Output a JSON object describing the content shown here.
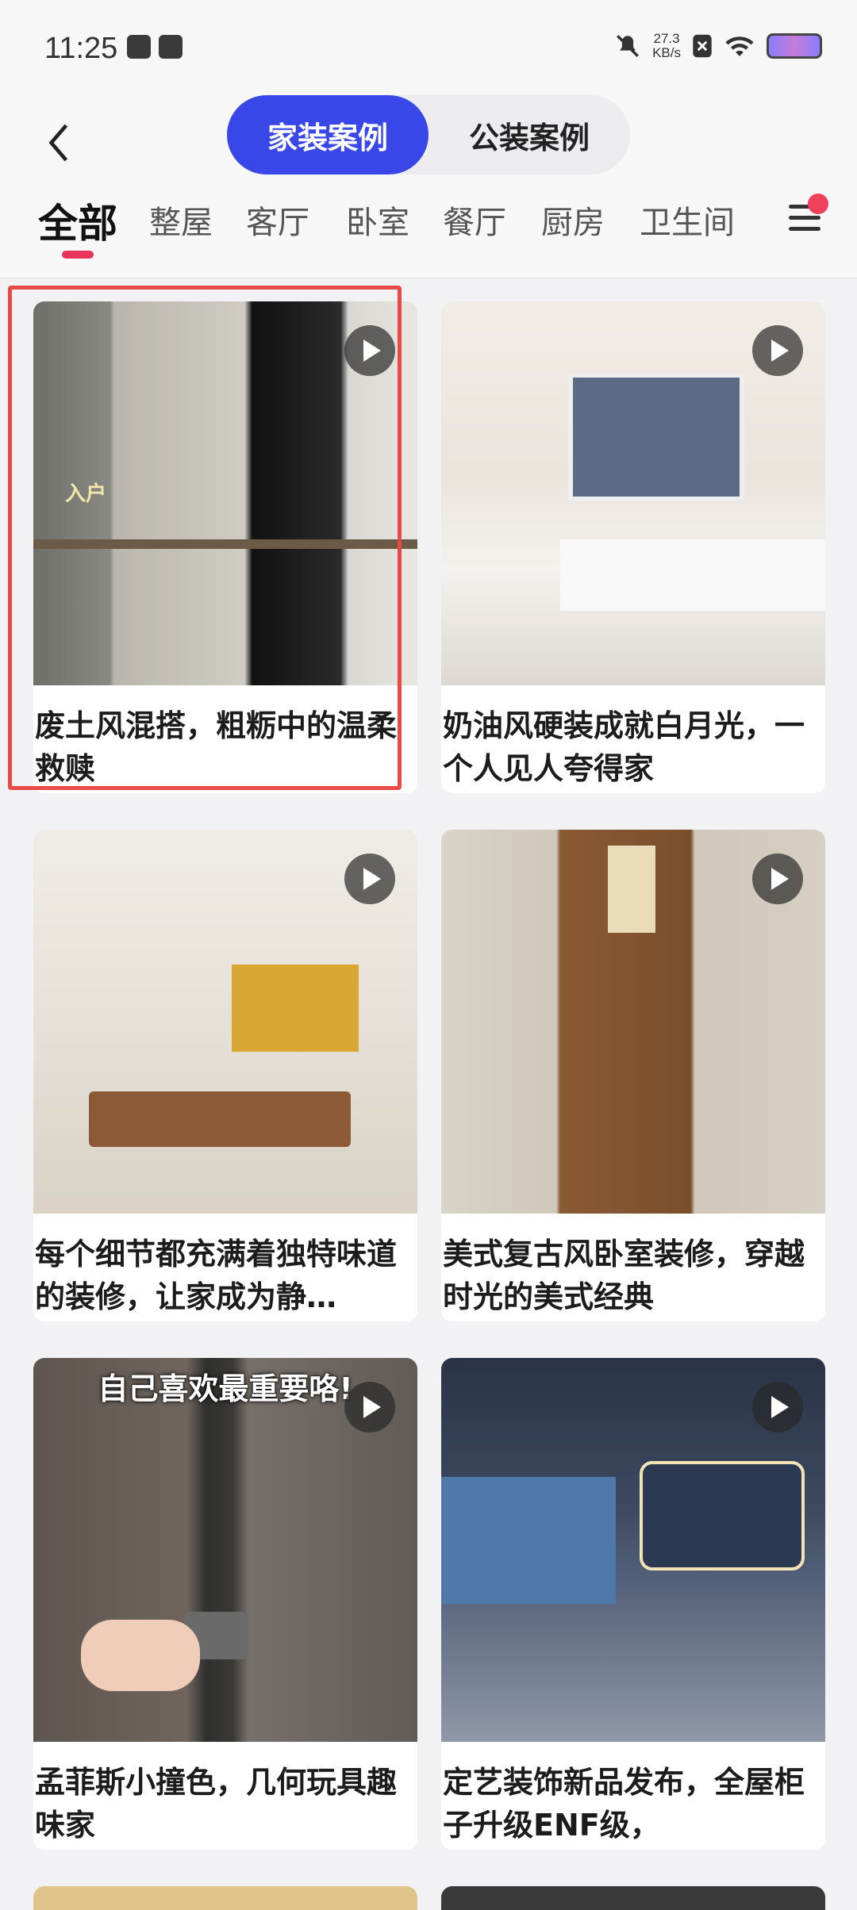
{
  "status_bar": {
    "time": "11:25",
    "net_speed_value": "27.3",
    "net_speed_unit": "KB/s"
  },
  "header": {
    "back_icon": "chevron-left-icon",
    "tabs": [
      {
        "label": "家装案例"
      },
      {
        "label": "公装案例"
      }
    ]
  },
  "categories": [
    {
      "label": "全部"
    },
    {
      "label": "整屋"
    },
    {
      "label": "客厅"
    },
    {
      "label": "卧室"
    },
    {
      "label": "餐厅"
    },
    {
      "label": "厨房"
    },
    {
      "label": "卫生间"
    }
  ],
  "cards": [
    {
      "title": "废土风混搭，粗粝中的温柔救赎",
      "overlay": "",
      "badge": "入户"
    },
    {
      "title": "奶油风硬装成就白月光，一个人见人夸得家",
      "overlay": ""
    },
    {
      "title": "每个细节都充满着独特味道的装修，让家成为静…",
      "overlay": ""
    },
    {
      "title": "美式复古风卧室装修，穿越时光的美式经典",
      "overlay": ""
    },
    {
      "title": "孟菲斯小撞色，几何玩具趣味家",
      "overlay": "自己喜欢最重要咯!"
    },
    {
      "title": "定艺装饰新品发布，全屋柜子升级ENF级，",
      "overlay": ""
    }
  ],
  "colors": {
    "accent": "#3a47e8",
    "tab_indicator": "#e8335a",
    "highlight": "#e84a48"
  }
}
